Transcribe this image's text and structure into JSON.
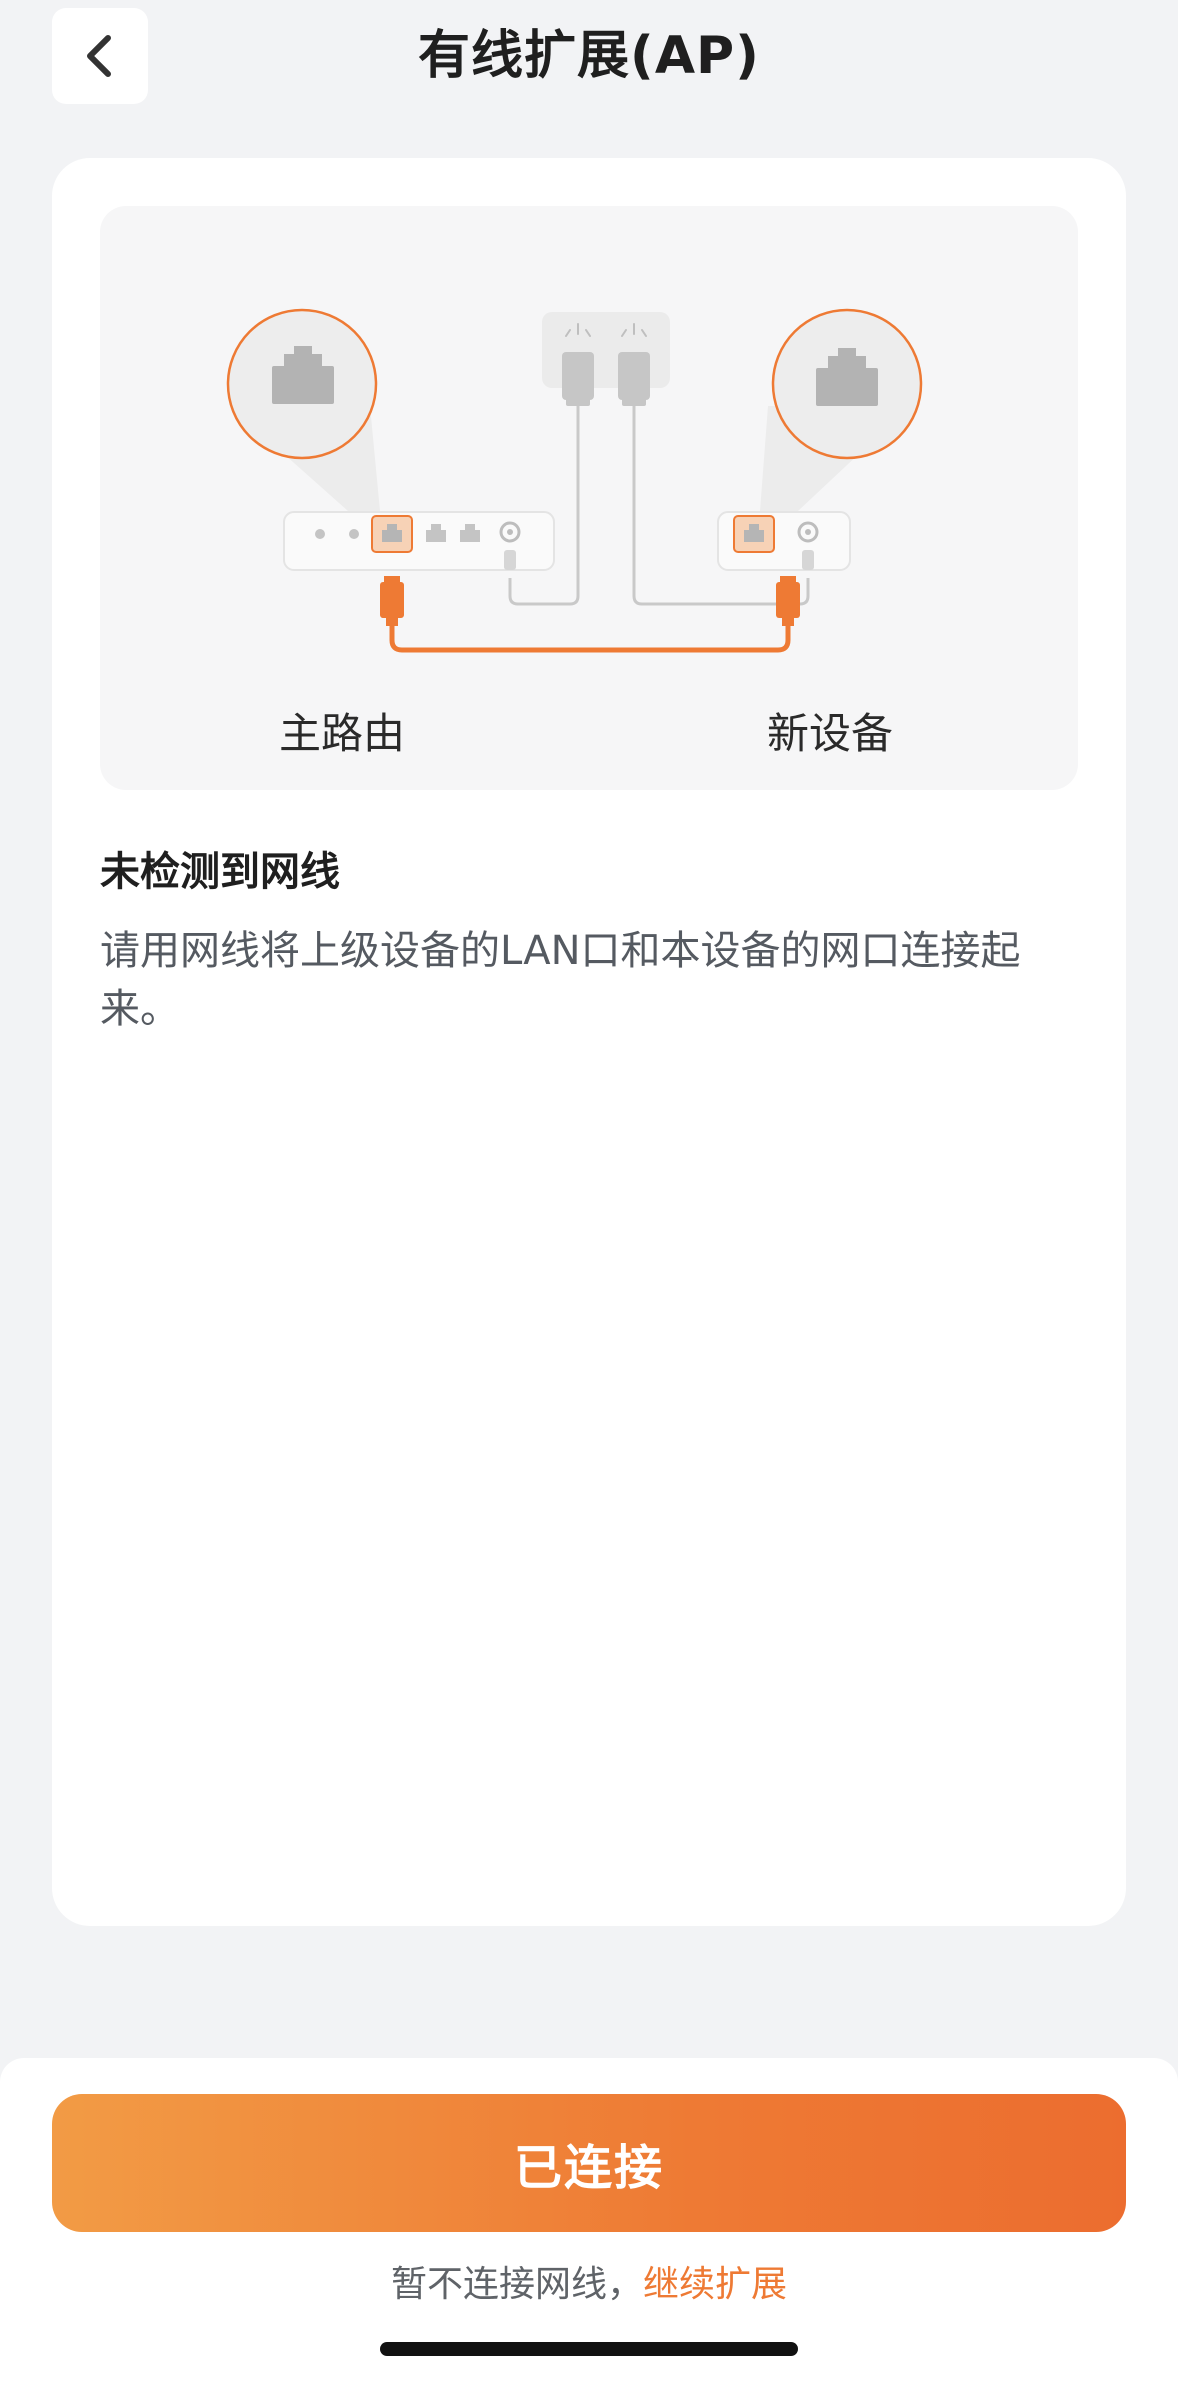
{
  "header": {
    "title": "有线扩展(AP)",
    "back_icon": "chevron-left-icon"
  },
  "illustration": {
    "main_router_label": "主路由",
    "new_device_label": "新设备",
    "accent_color": "#ee7a34"
  },
  "status": {
    "title": "未检测到网线",
    "description": "请用网线将上级设备的LAN口和本设备的网口连接起来。"
  },
  "footer": {
    "primary_button": "已连接",
    "skip_prefix": "暂不连接网线，",
    "skip_link": "继续扩展"
  },
  "colors": {
    "brand": "#ee7a34",
    "background": "#f2f3f5"
  }
}
